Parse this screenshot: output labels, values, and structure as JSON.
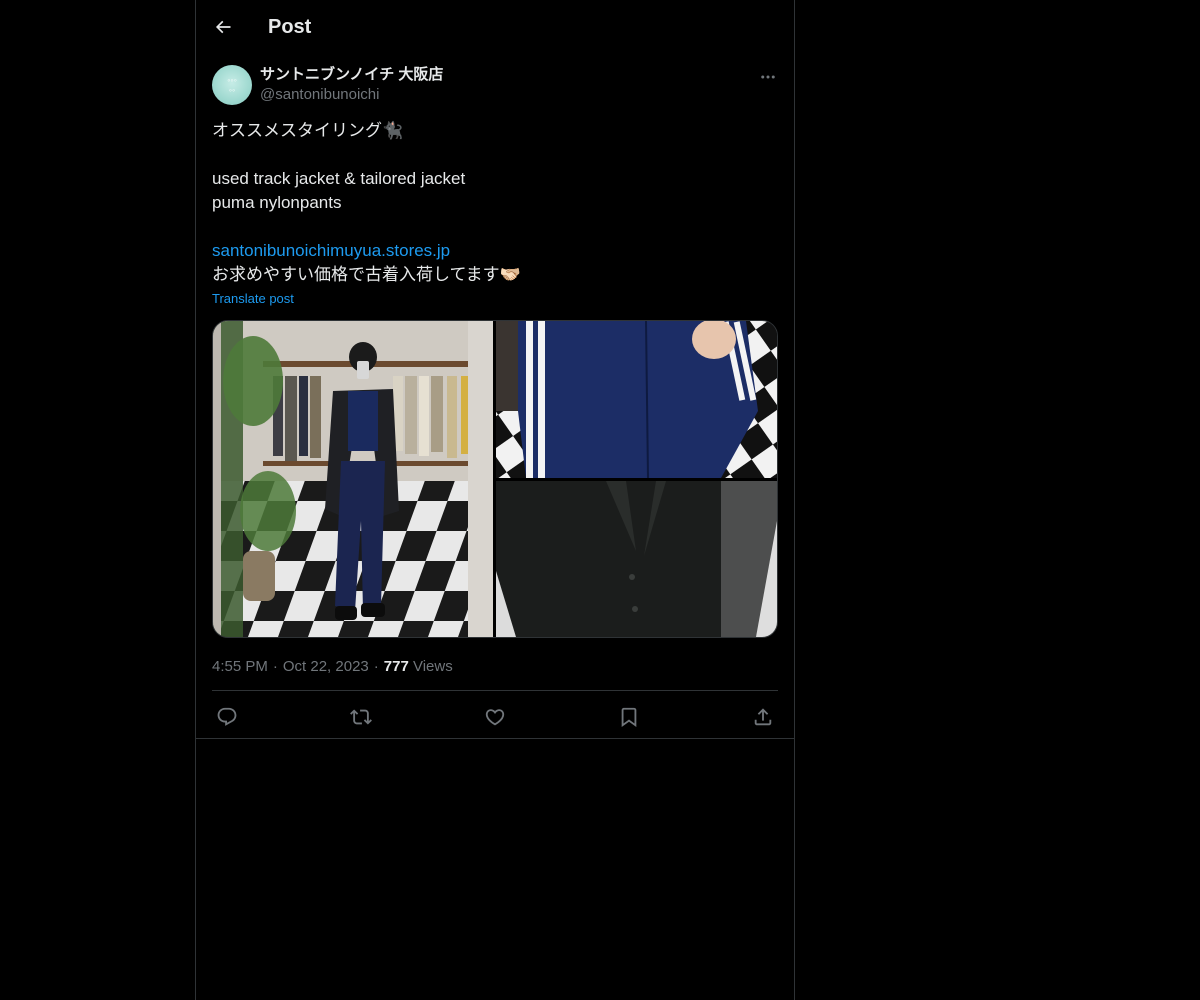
{
  "header": {
    "title": "Post",
    "back_icon": "arrow-left-icon"
  },
  "post": {
    "author": {
      "display_name": "サントニブンノイチ 大阪店",
      "handle": "@santonibunoichi",
      "avatar_color": "#a9e0d8"
    },
    "text_lines": [
      "オススメスタイリング🐈‍⬛",
      "",
      "used track jacket & tailored jacket",
      "puma nylonpants",
      ""
    ],
    "link": "santonibunoichimuyua.stores.jp",
    "text_after_link": "お求めやすい価格で古着入荷してます🫱🏻‍🫲🏼",
    "translate_label": "Translate post",
    "media": {
      "count": 3,
      "photos": [
        "full-length-mirror-selfie",
        "track-jacket-closeup",
        "tailored-jacket-closeup"
      ]
    },
    "meta": {
      "time": "4:55 PM",
      "separator": "·",
      "date": "Oct 22, 2023",
      "views_count": "777",
      "views_label": "Views"
    },
    "actions": [
      {
        "name": "reply",
        "icon": "reply-icon"
      },
      {
        "name": "repost",
        "icon": "repost-icon"
      },
      {
        "name": "like",
        "icon": "heart-icon"
      },
      {
        "name": "bookmark",
        "icon": "bookmark-icon"
      },
      {
        "name": "share",
        "icon": "share-icon"
      }
    ]
  },
  "colors": {
    "background": "#000000",
    "text": "#e7e9ea",
    "secondary_text": "#71767b",
    "link": "#1d9bf0",
    "border": "#2f3336"
  }
}
